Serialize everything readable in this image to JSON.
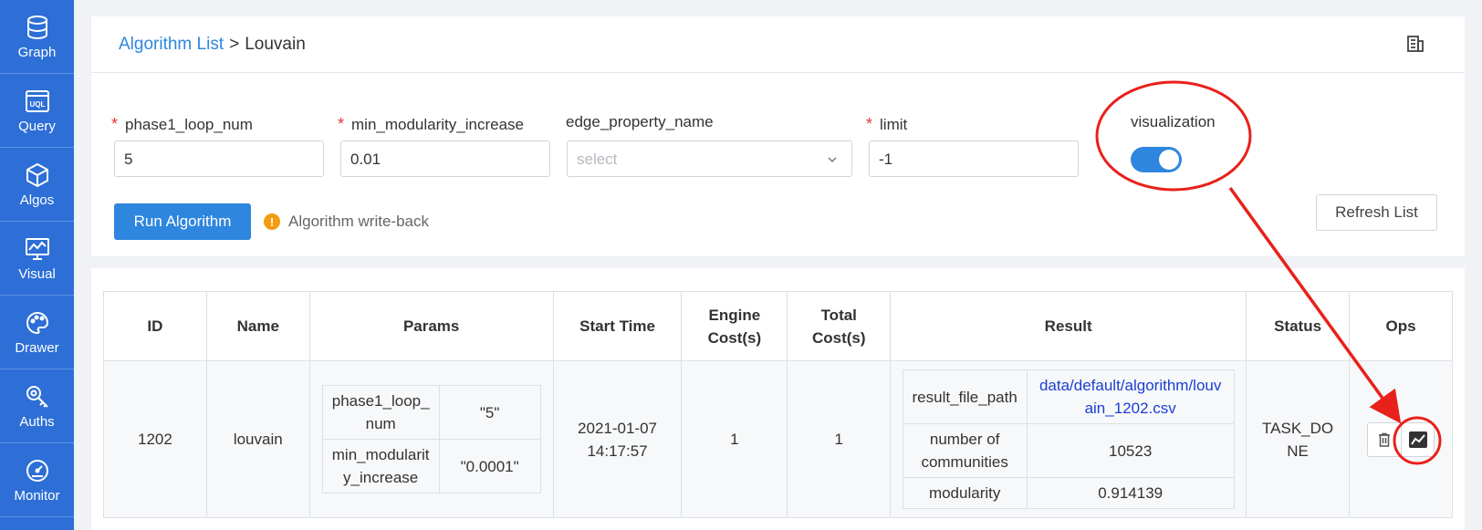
{
  "sidebar": {
    "items": [
      {
        "label": "Graph",
        "icon": "database-icon"
      },
      {
        "label": "Query",
        "icon": "uql-icon"
      },
      {
        "label": "Algos",
        "icon": "cube-icon"
      },
      {
        "label": "Visual",
        "icon": "monitor-chart-icon"
      },
      {
        "label": "Drawer",
        "icon": "palette-icon"
      },
      {
        "label": "Auths",
        "icon": "key-icon"
      },
      {
        "label": "Monitor",
        "icon": "gauge-icon"
      }
    ]
  },
  "breadcrumb": {
    "link": "Algorithm List",
    "separator": ">",
    "current": "Louvain"
  },
  "form": {
    "phase1": {
      "label": "phase1_loop_num",
      "value": "5"
    },
    "min_mod": {
      "label": "min_modularity_increase",
      "value": "0.01"
    },
    "edge_prop": {
      "label": "edge_property_name",
      "placeholder": "select"
    },
    "limit": {
      "label": "limit",
      "value": "-1"
    },
    "visualization": {
      "label": "visualization",
      "enabled": true
    },
    "run_button": "Run Algorithm",
    "writeback_text": "Algorithm write-back",
    "refresh_button": "Refresh List"
  },
  "table": {
    "headers": {
      "id": "ID",
      "name": "Name",
      "params": "Params",
      "start": "Start Time",
      "engine1": "Engine",
      "engine2": "Cost(s)",
      "total1": "Total",
      "total2": "Cost(s)",
      "result": "Result",
      "status": "Status",
      "ops": "Ops"
    },
    "row": {
      "id": "1202",
      "name": "louvain",
      "params": [
        {
          "k1": "phase1_loop_",
          "k2": "num",
          "v": "\"5\""
        },
        {
          "k1": "min_modularit",
          "k2": "y_increase",
          "v": "\"0.0001\""
        }
      ],
      "start1": "2021-01-07",
      "start2": "14:17:57",
      "engine_cost": "1",
      "total_cost": "1",
      "result": {
        "file_key": "result_file_path",
        "file_val1": "data/default/algorithm/louv",
        "file_val2": "ain_1202.csv",
        "comm_key1": "number of",
        "comm_key2": "communities",
        "comm_val": "10523",
        "mod_key": "modularity",
        "mod_val": "0.914139"
      },
      "status1": "TASK_DO",
      "status2": "NE"
    }
  },
  "colors": {
    "sidebar": "#2d6fd6",
    "primary": "#2e86de",
    "annotation": "#e8211b",
    "warning": "#f39c12"
  }
}
